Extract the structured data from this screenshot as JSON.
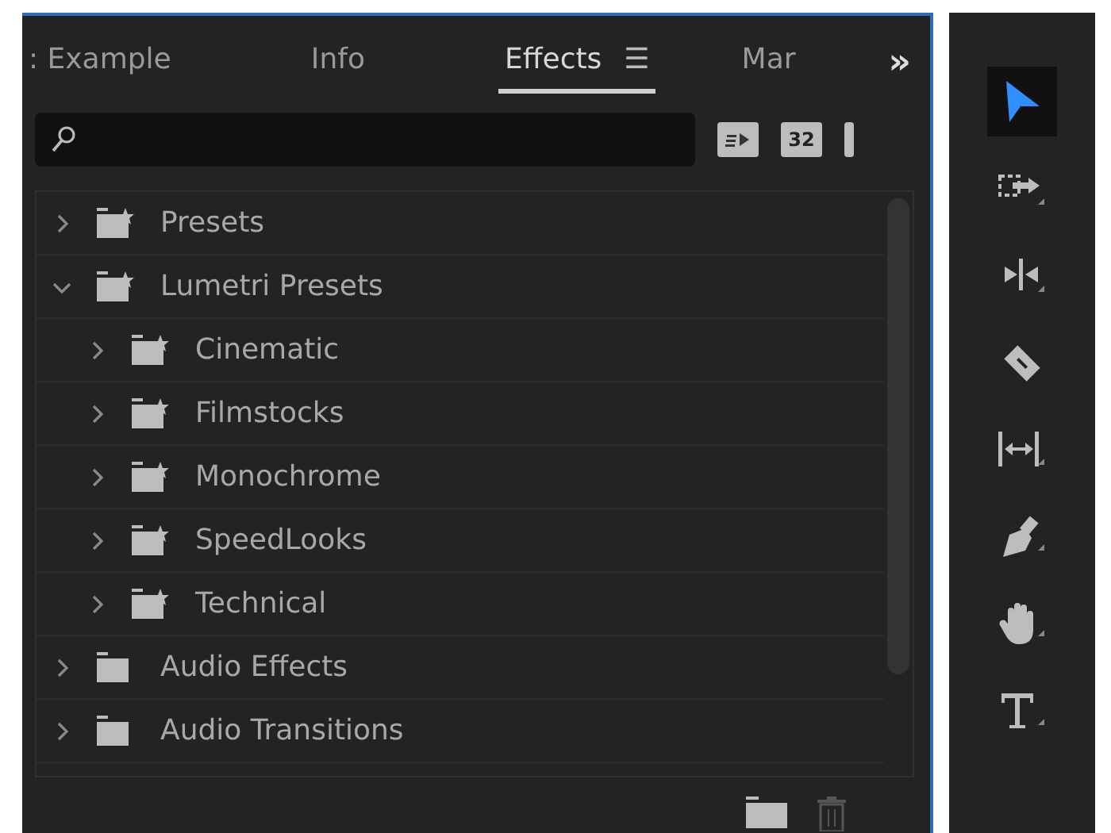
{
  "tabs": [
    {
      "label": ": Example",
      "selected": false
    },
    {
      "label": "Info",
      "selected": false
    },
    {
      "label": "Effects",
      "selected": true,
      "menu_icon": "☰"
    },
    {
      "label": "Mar",
      "selected": false
    }
  ],
  "overflow": "»",
  "filter_buttons": [
    {
      "kind": "accelerated"
    },
    {
      "kind": "bit32",
      "label": "32"
    },
    {
      "kind": "partial"
    }
  ],
  "tree": [
    {
      "label": "Presets",
      "kind": "preset",
      "expanded": false
    },
    {
      "label": "Lumetri Presets",
      "kind": "preset",
      "expanded": true,
      "children": [
        {
          "label": "Cinematic",
          "kind": "preset",
          "expanded": false
        },
        {
          "label": "Filmstocks",
          "kind": "preset",
          "expanded": false
        },
        {
          "label": "Monochrome",
          "kind": "preset",
          "expanded": false
        },
        {
          "label": "SpeedLooks",
          "kind": "preset",
          "expanded": false
        },
        {
          "label": "Technical",
          "kind": "preset",
          "expanded": false
        }
      ]
    },
    {
      "label": "Audio Effects",
      "kind": "folder",
      "expanded": false
    },
    {
      "label": "Audio Transitions",
      "kind": "folder",
      "expanded": false
    }
  ],
  "tools": [
    {
      "kind": "selection",
      "selected": true
    },
    {
      "kind": "track-select",
      "selected": false
    },
    {
      "kind": "ripple",
      "selected": false
    },
    {
      "kind": "razor",
      "selected": false
    },
    {
      "kind": "slip",
      "selected": false
    },
    {
      "kind": "pen",
      "selected": false
    },
    {
      "kind": "hand",
      "selected": false
    },
    {
      "kind": "type",
      "selected": false
    }
  ]
}
